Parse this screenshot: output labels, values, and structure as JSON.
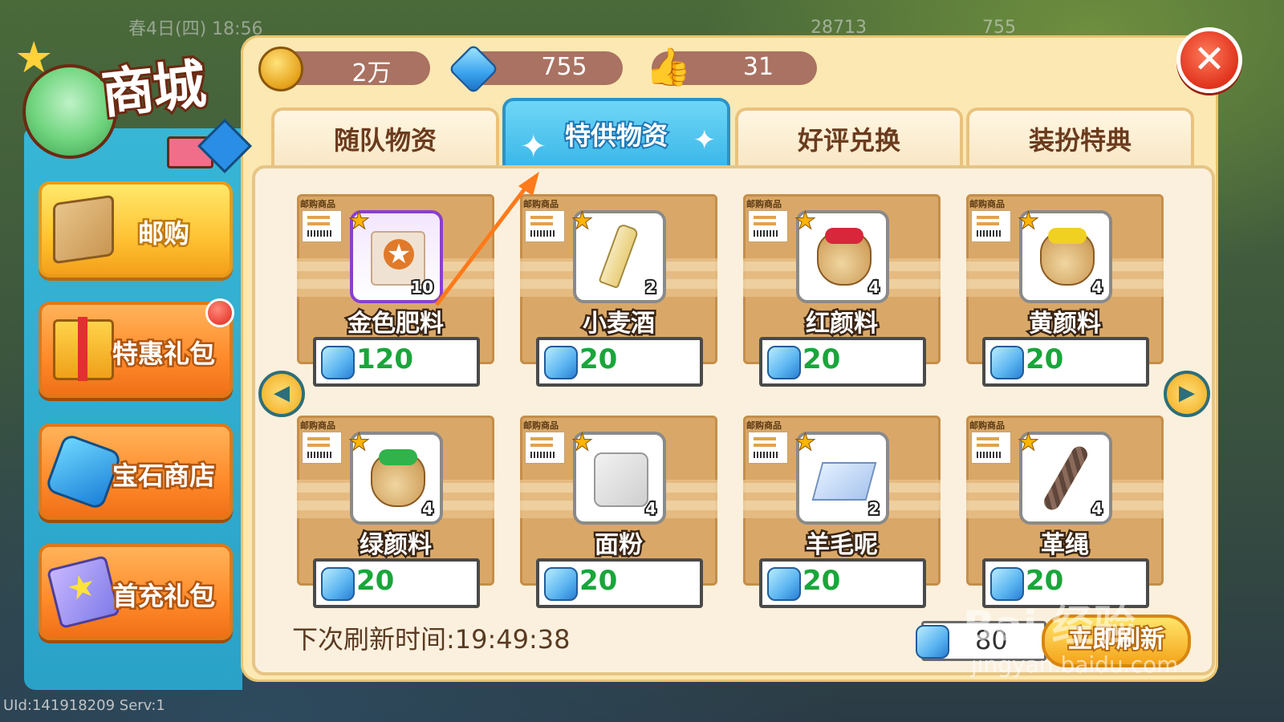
{
  "background": {
    "top_text": "春4日(四) 18:56",
    "coins_bg": "28713",
    "gems_bg": "755",
    "uid": "UId:141918209 Serv:1"
  },
  "logo": {
    "title": "商城"
  },
  "sidebar": {
    "items": [
      {
        "label": "邮购",
        "icon": "box-icon"
      },
      {
        "label": "特惠礼包",
        "icon": "gift-icon",
        "badge": true
      },
      {
        "label": "宝石商店",
        "icon": "gem-icon"
      },
      {
        "label": "首充礼包",
        "icon": "card-icon"
      }
    ]
  },
  "currency": {
    "coins": "2万",
    "gems": "755",
    "likes": "31"
  },
  "tabs": [
    {
      "label": "随队物资"
    },
    {
      "label": "特供物资",
      "active": true
    },
    {
      "label": "好评兑换"
    },
    {
      "label": "装扮特典"
    }
  ],
  "card_tag": "邮购商品",
  "items": [
    {
      "name": "金色肥料",
      "count": "10",
      "price": "120",
      "art": "bag"
    },
    {
      "name": "小麦酒",
      "count": "2",
      "price": "20",
      "art": "bottle"
    },
    {
      "name": "红颜料",
      "count": "4",
      "price": "20",
      "art": "pot-red"
    },
    {
      "name": "黄颜料",
      "count": "4",
      "price": "20",
      "art": "pot-yellow"
    },
    {
      "name": "绿颜料",
      "count": "4",
      "price": "20",
      "art": "pot-green"
    },
    {
      "name": "面粉",
      "count": "4",
      "price": "20",
      "art": "flour"
    },
    {
      "name": "羊毛呢",
      "count": "2",
      "price": "20",
      "art": "wool"
    },
    {
      "name": "革绳",
      "count": "4",
      "price": "20",
      "art": "rope"
    }
  ],
  "footer": {
    "refresh_time": "下次刷新时间:19:49:38",
    "refresh_cost": "80",
    "refresh_button": "立即刷新"
  },
  "watermark": {
    "main": "Bai 经验",
    "sub": "jingyan.baidu.com"
  },
  "colors": {
    "panel": "#fbe8b2",
    "active_tab": "#38b5e8",
    "price_text": "#19a63a",
    "sidebar": "#2aa2c8"
  }
}
